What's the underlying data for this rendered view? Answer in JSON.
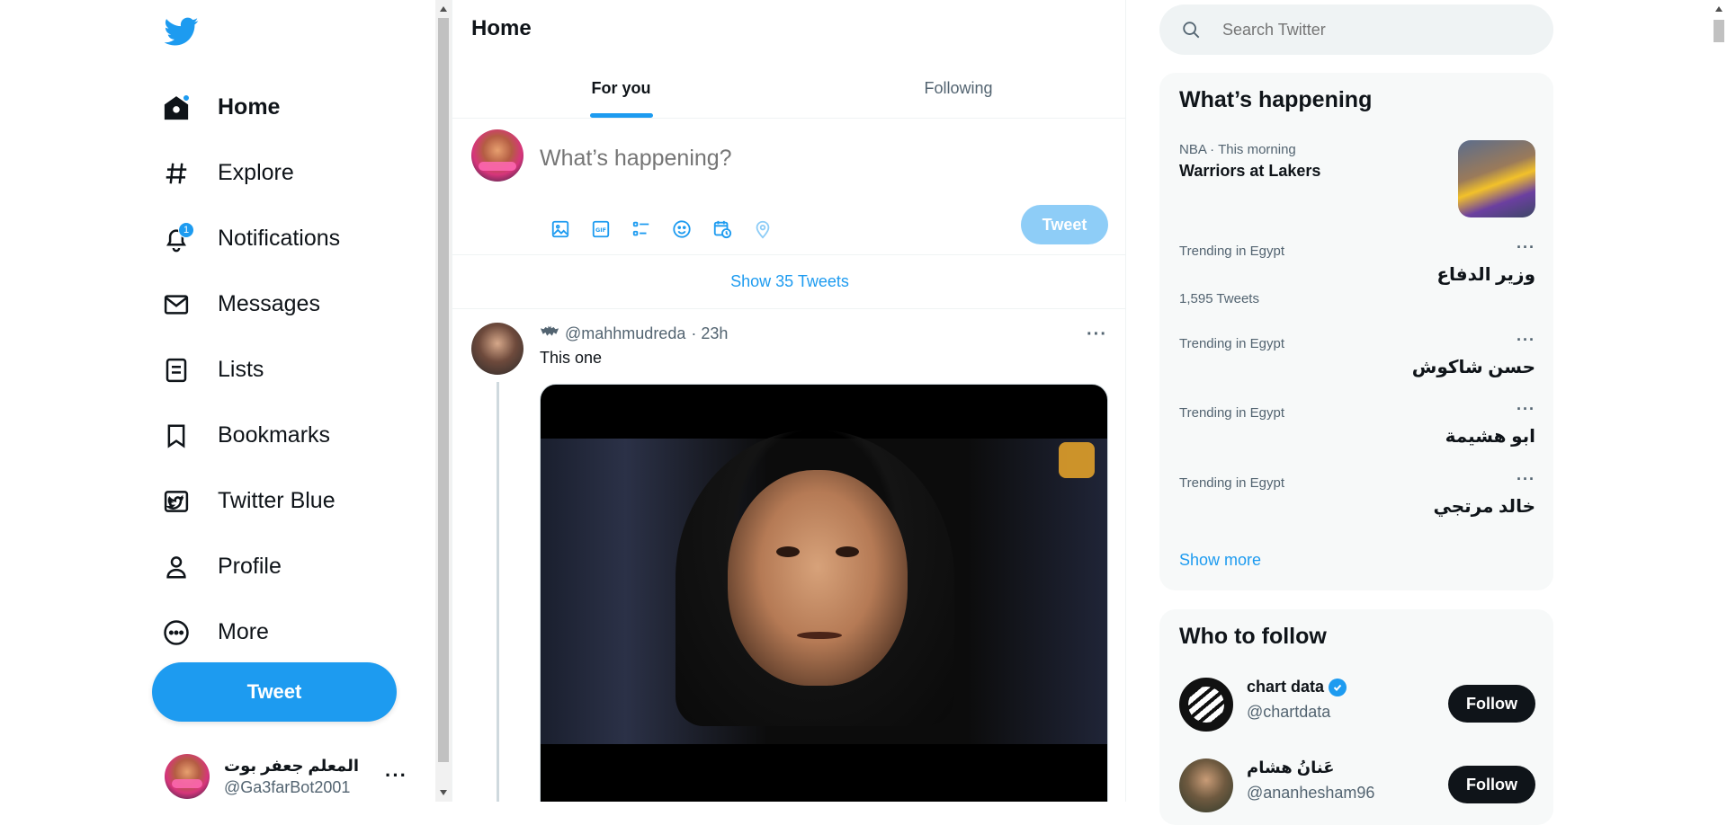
{
  "sidebar": {
    "items": [
      {
        "label": "Home",
        "icon": "home-icon"
      },
      {
        "label": "Explore",
        "icon": "hashtag-icon"
      },
      {
        "label": "Notifications",
        "icon": "bell-icon",
        "badge": "1"
      },
      {
        "label": "Messages",
        "icon": "mail-icon"
      },
      {
        "label": "Lists",
        "icon": "list-icon"
      },
      {
        "label": "Bookmarks",
        "icon": "bookmark-icon"
      },
      {
        "label": "Twitter Blue",
        "icon": "twitter-blue-icon"
      },
      {
        "label": "Profile",
        "icon": "person-icon"
      },
      {
        "label": "More",
        "icon": "more-circle-icon"
      }
    ],
    "tweet_button": "Tweet",
    "account": {
      "name": "المعلم جعفر بوت",
      "handle": "@Ga3farBot2001",
      "more": "···"
    }
  },
  "main": {
    "title": "Home",
    "tabs": [
      {
        "label": "For you"
      },
      {
        "label": "Following"
      }
    ],
    "compose": {
      "placeholder": "What’s happening?",
      "tweet_button": "Tweet"
    },
    "show_tweets": "Show 35 Tweets",
    "tweet": {
      "handle": "@mahhmudreda",
      "time": "· 23h",
      "text": "This one",
      "more": "···"
    }
  },
  "right": {
    "search_placeholder": "Search Twitter",
    "happening": {
      "title": "What’s happening",
      "trends": [
        {
          "meta": "NBA · This morning",
          "name": "Warriors at Lakers"
        },
        {
          "meta": "Trending in Egypt",
          "name": "وزير الدفاع",
          "count": "1,595 Tweets"
        },
        {
          "meta": "Trending in Egypt",
          "name": "حسن شاكوش"
        },
        {
          "meta": "Trending in Egypt",
          "name": "ابو هشيمة"
        },
        {
          "meta": "Trending in Egypt",
          "name": "خالد مرتجي"
        }
      ],
      "dots": "···",
      "show_more": "Show more"
    },
    "who_to_follow": {
      "title": "Who to follow",
      "accounts": [
        {
          "name": "chart data",
          "handle": "@chartdata",
          "verified": true,
          "button": "Follow"
        },
        {
          "name": "عَنانُ هشام",
          "handle": "@ananhesham96",
          "button": "Follow"
        }
      ]
    }
  },
  "colors": {
    "accent": "#1d9bf0",
    "text": "#0f1419",
    "muted": "#536471",
    "panel": "#f7f9f9"
  }
}
